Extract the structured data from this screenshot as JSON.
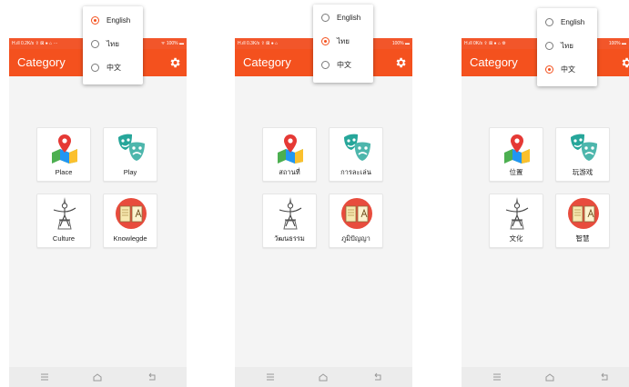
{
  "colors": {
    "accent": "#f4511e",
    "statusbar": "#f2562a",
    "background": "#f4f4f4",
    "radio_off": "#7a7a7a"
  },
  "screens": [
    {
      "status_left": "H.ıll 0.2K/s ⇪ ⊠ ● ⌂ ···",
      "status_right": "ᯤ 100% ▬",
      "title": "Category",
      "settings_icon": "gear-icon",
      "menu": [
        {
          "label": "English",
          "selected": true
        },
        {
          "label": "ไทย",
          "selected": false
        },
        {
          "label": "中文",
          "selected": false
        }
      ],
      "tiles": [
        {
          "label": "Place",
          "icon": "map-pin-icon"
        },
        {
          "label": "Play",
          "icon": "theatre-masks-icon"
        },
        {
          "label": "Culture",
          "icon": "thai-dancer-icon"
        },
        {
          "label": "Knowlegde",
          "icon": "book-icon"
        }
      ]
    },
    {
      "status_left": "H.ıll 0.3K/s ⇪ ⊠ ● ⌂",
      "status_right": "100% ▬",
      "title": "Category",
      "settings_icon": "gear-icon",
      "menu": [
        {
          "label": "English",
          "selected": false
        },
        {
          "label": "ไทย",
          "selected": true
        },
        {
          "label": "中文",
          "selected": false
        }
      ],
      "tiles": [
        {
          "label": "สถานที่",
          "icon": "map-pin-icon"
        },
        {
          "label": "การละเล่น",
          "icon": "theatre-masks-icon"
        },
        {
          "label": "วัฒนธรรม",
          "icon": "thai-dancer-icon"
        },
        {
          "label": "ภูมิปัญญา",
          "icon": "book-icon"
        }
      ]
    },
    {
      "status_left": "H.ıll 0K/s ⇪ ⊠ ● ⌂ ⚙",
      "status_right": "100% ▬",
      "title": "Category",
      "settings_icon": "gear-icon",
      "menu": [
        {
          "label": "English",
          "selected": false
        },
        {
          "label": "ไทย",
          "selected": false
        },
        {
          "label": "中文",
          "selected": true
        }
      ],
      "tiles": [
        {
          "label": "位置",
          "icon": "map-pin-icon"
        },
        {
          "label": "玩游戏",
          "icon": "theatre-masks-icon"
        },
        {
          "label": "文化",
          "icon": "thai-dancer-icon"
        },
        {
          "label": "智慧",
          "icon": "book-icon"
        }
      ]
    }
  ],
  "navbar": {
    "icons": [
      "menu-icon",
      "home-icon",
      "back-icon"
    ]
  }
}
